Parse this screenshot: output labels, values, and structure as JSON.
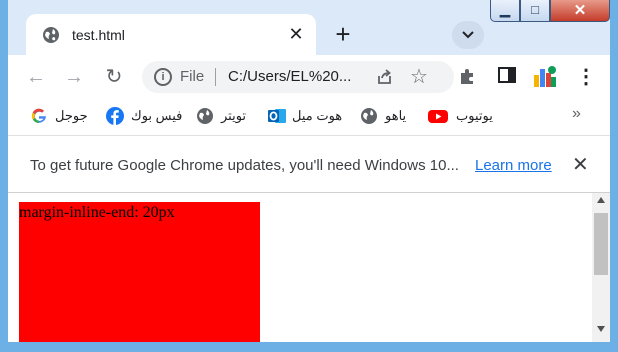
{
  "tab": {
    "title": "test.html",
    "close": "✕",
    "new_tab": "+"
  },
  "window_controls": {
    "minimize": "▁",
    "maximize": "□",
    "close": "✕"
  },
  "toolbar": {
    "back": "←",
    "forward": "→",
    "reload": "↻",
    "info": "i",
    "scheme_label": "File",
    "url": "C:/Users/EL%20...",
    "star": "☆",
    "menu": "⋮"
  },
  "bookmarks": [
    {
      "label": "جوجل",
      "icon": "google-icon"
    },
    {
      "label": "فيس بوك",
      "icon": "facebook-icon"
    },
    {
      "label": "تويتر",
      "icon": "globe-icon"
    },
    {
      "label": "هوت ميل",
      "icon": "outlook-icon"
    },
    {
      "label": "ياهو",
      "icon": "globe-icon"
    },
    {
      "label": "يوتيوب",
      "icon": "youtube-icon"
    }
  ],
  "bookmarks_more": "»",
  "infobar": {
    "message": "To get future Google Chrome updates, you'll need Windows 10...",
    "link": "Learn more",
    "close": "✕"
  },
  "page": {
    "box_text": "margin-inline-end: 20px"
  },
  "colors": {
    "frame": "#6cb0e6",
    "box": "#ff0000",
    "link": "#1a73e8"
  }
}
